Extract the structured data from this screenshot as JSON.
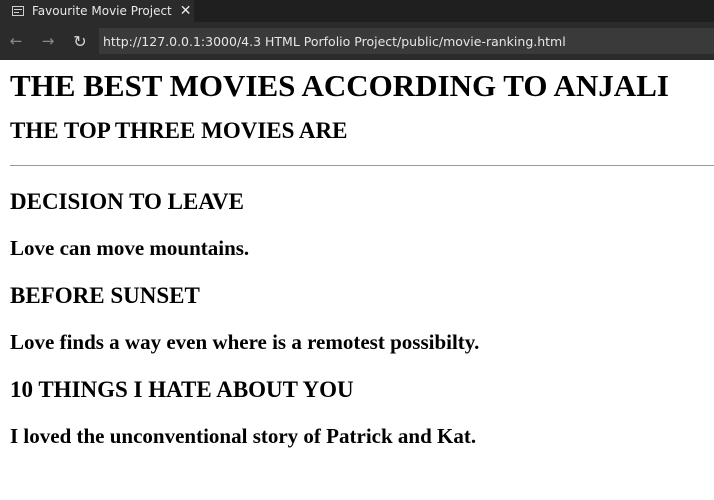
{
  "browser": {
    "tab_title": "Favourite Movie Project",
    "tab_close": "✕",
    "url": "http://127.0.0.1:3000/4.3 HTML Porfolio Project/public/movie-ranking.html",
    "back_glyph": "←",
    "forward_glyph": "→",
    "reload_glyph": "↻"
  },
  "page": {
    "title": "THE BEST MOVIES ACCORDING TO ANJALI",
    "subtitle": "THE TOP THREE MOVIES ARE",
    "movies": [
      {
        "title": "DECISION TO LEAVE",
        "review": "Love can move mountains."
      },
      {
        "title": "BEFORE SUNSET",
        "review": "Love finds a way even where is a remotest possibilty."
      },
      {
        "title": "10 THINGS I HATE ABOUT YOU",
        "review": "I loved the unconventional story of Patrick and Kat."
      }
    ]
  }
}
